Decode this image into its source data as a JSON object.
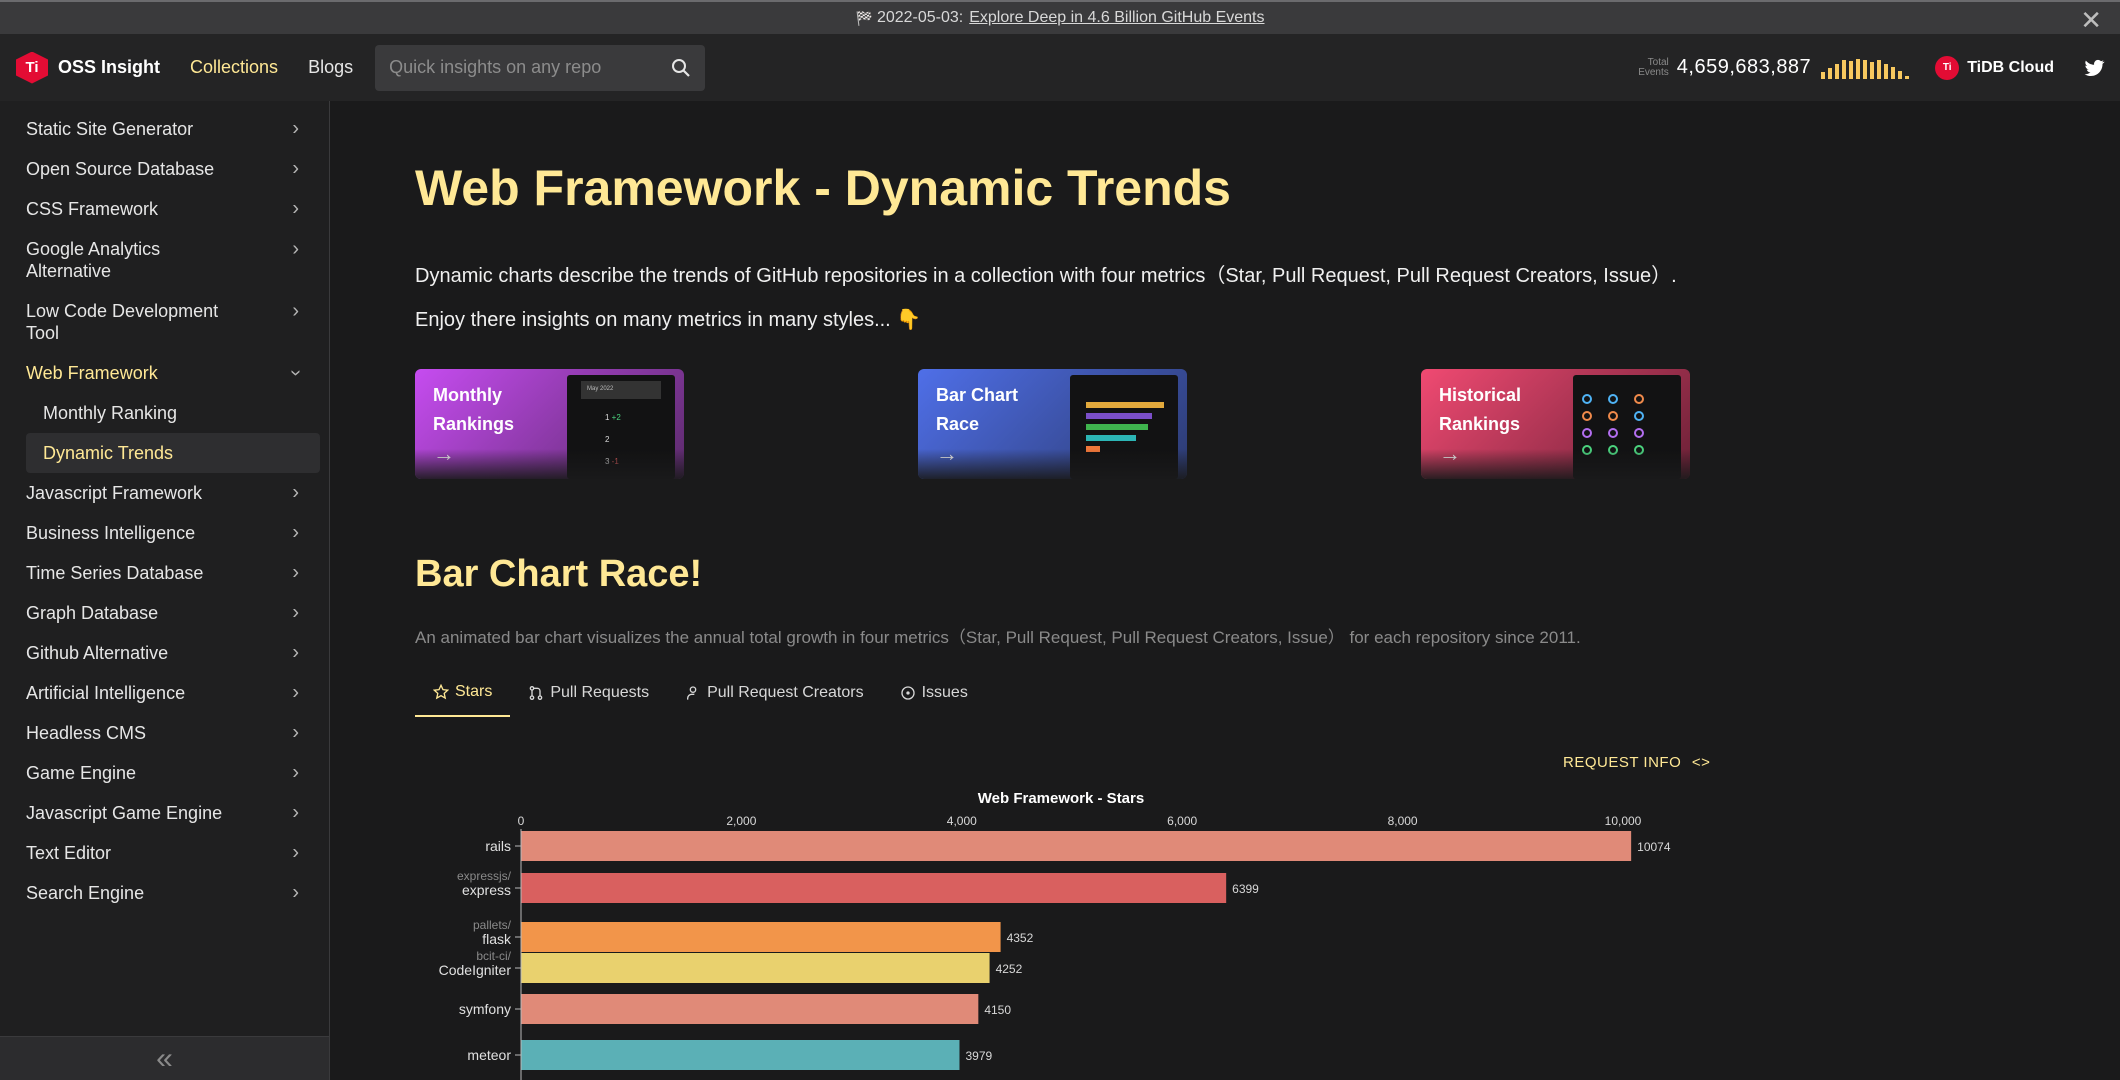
{
  "announcement": {
    "flag_icon": "checkered-flag-icon",
    "date": "2022-05-03:",
    "link": "Explore Deep in 4.6 Billion GitHub Events",
    "close": "✕"
  },
  "navbar": {
    "logo": "OSS Insight",
    "links": [
      "Collections",
      "Blogs"
    ],
    "search_placeholder": "Quick insights on any repo",
    "events_label_1": "Total",
    "events_label_2": "Events",
    "events_total": "4,659,683,887",
    "sparkline_levels": [
      0.3,
      0.5,
      0.7,
      0.85,
      0.8,
      0.9,
      0.85,
      0.75,
      0.85,
      0.7,
      0.55,
      0.35,
      0.15
    ],
    "tidb": "TiDB Cloud",
    "colors": {
      "accent": "#ffe895",
      "brand": "#e30c34"
    }
  },
  "sidebar": {
    "items": [
      {
        "label": "Static Site Generator"
      },
      {
        "label": "Open Source Database"
      },
      {
        "label": "CSS Framework"
      },
      {
        "label_1": "Google Analytics",
        "label_2": "Alternative"
      },
      {
        "label_1": "Low Code Development",
        "label_2": "Tool"
      },
      {
        "label": "Web Framework",
        "expanded": true
      }
    ],
    "sub_items": [
      "Monthly Ranking",
      "Dynamic Trends"
    ],
    "more_items": [
      "Javascript Framework",
      "Business Intelligence",
      "Time Series Database",
      "Graph Database",
      "Github Alternative",
      "Artificial Intelligence",
      "Headless CMS",
      "Game Engine",
      "Javascript Game Engine",
      "Text Editor",
      "Search Engine"
    ],
    "collapse": "«"
  },
  "main": {
    "title": "Web Framework - Dynamic Trends",
    "desc": "Dynamic charts describe the trends of GitHub repositories in a collection with four metrics（Star, Pull Request, Pull Request Creators, Issue）.",
    "desc2": "Enjoy there insights on many metrics in many styles... 👇",
    "cards": [
      {
        "line1": "Monthly",
        "line2": "Rankings",
        "arrow": "→",
        "thumb_title": "May 2022"
      },
      {
        "line1": "Bar Chart",
        "line2": "Race",
        "arrow": "→"
      },
      {
        "line1": "Historical",
        "line2": "Rankings",
        "arrow": "→"
      }
    ],
    "section_title": "Bar Chart Race!",
    "section_desc": "An animated bar chart visualizes the annual total growth in four metrics（Star, Pull Request, Pull Request Creators, Issue） for each repository since 2011.",
    "tabs": [
      "Stars",
      "Pull Requests",
      "Pull Request Creators",
      "Issues"
    ],
    "request_info": "REQUEST INFO",
    "request_icon": "<>"
  },
  "chart_data": {
    "type": "bar",
    "title": "Web Framework - Stars",
    "xlim": [
      0,
      10500
    ],
    "ticks": [
      0,
      2000,
      4000,
      6000,
      8000,
      10000
    ],
    "tick_labels": [
      "0",
      "2,000",
      "4,000",
      "6,000",
      "8,000",
      "10,000"
    ],
    "bars": [
      {
        "owner": "",
        "name": "rails",
        "value": 10074,
        "color": "#e08a78"
      },
      {
        "owner": "expressjs/",
        "name": "express",
        "value": 6399,
        "color": "#d9605f"
      },
      {
        "owner": "pallets/",
        "name": "flask",
        "value": 4352,
        "color": "#f2954a"
      },
      {
        "owner": "bcit-ci/",
        "name": "CodeIgniter",
        "value": 4252,
        "color": "#e9d16e"
      },
      {
        "owner": "",
        "name": "symfony",
        "value": 4150,
        "color": "#e08a78"
      },
      {
        "owner": "",
        "name": "meteor",
        "value": 3979,
        "color": "#5bb0b6"
      }
    ]
  }
}
